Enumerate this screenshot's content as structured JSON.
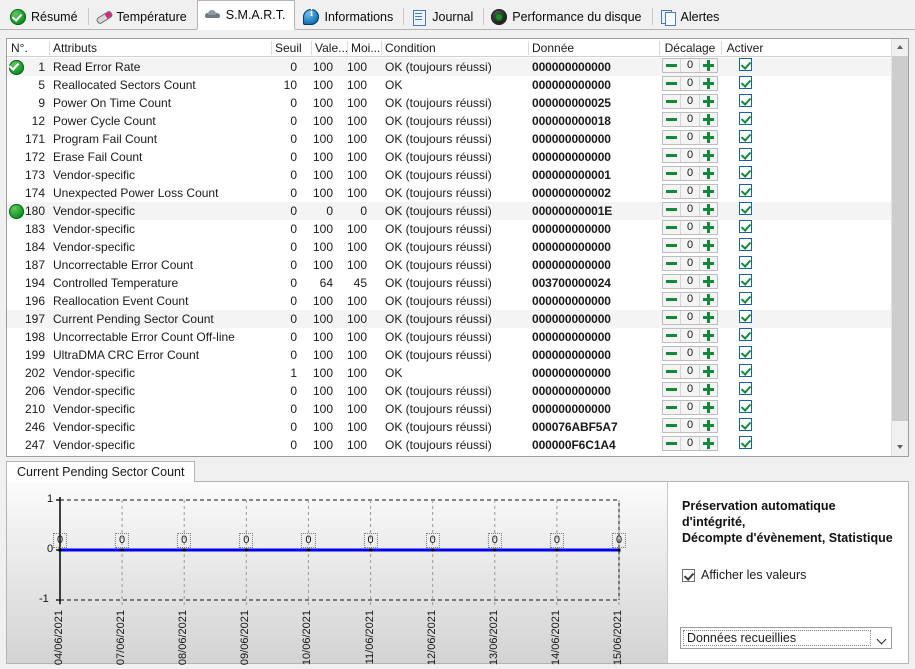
{
  "tabs": [
    {
      "label": "Résumé",
      "icon": "green-check-icon",
      "active": false
    },
    {
      "label": "Température",
      "icon": "thermometer-icon",
      "active": false
    },
    {
      "label": "S.M.A.R.T.",
      "icon": "smart-disk-icon",
      "active": true
    },
    {
      "label": "Informations",
      "icon": "info-icon",
      "active": false
    },
    {
      "label": "Journal",
      "icon": "document-icon",
      "active": false
    },
    {
      "label": "Performance du disque",
      "icon": "gauge-icon",
      "active": false
    },
    {
      "label": "Alertes",
      "icon": "copy-pages-icon",
      "active": false
    }
  ],
  "grid": {
    "columns": [
      "N°.",
      "Attributs",
      "Seuil",
      "Vale...",
      "Moi...",
      "Condition",
      "Donnée",
      "Décalage",
      "Activer"
    ],
    "rows": [
      {
        "status": "ok",
        "no": "1",
        "attr": "Read Error Rate",
        "seuil": "0",
        "valeur": "100",
        "moindre": "100",
        "condition": "OK (toujours réussi)",
        "donnee": "000000000000",
        "decalage": "0",
        "activer": true,
        "highlight": true
      },
      {
        "status": "",
        "no": "5",
        "attr": "Reallocated Sectors Count",
        "seuil": "10",
        "valeur": "100",
        "moindre": "100",
        "condition": "OK",
        "donnee": "000000000000",
        "decalage": "0",
        "activer": true,
        "highlight": false
      },
      {
        "status": "",
        "no": "9",
        "attr": "Power On Time Count",
        "seuil": "0",
        "valeur": "100",
        "moindre": "100",
        "condition": "OK (toujours réussi)",
        "donnee": "000000000025",
        "decalage": "0",
        "activer": true,
        "highlight": false
      },
      {
        "status": "",
        "no": "12",
        "attr": "Power Cycle Count",
        "seuil": "0",
        "valeur": "100",
        "moindre": "100",
        "condition": "OK (toujours réussi)",
        "donnee": "000000000018",
        "decalage": "0",
        "activer": true,
        "highlight": false
      },
      {
        "status": "",
        "no": "171",
        "attr": "Program Fail Count",
        "seuil": "0",
        "valeur": "100",
        "moindre": "100",
        "condition": "OK (toujours réussi)",
        "donnee": "000000000000",
        "decalage": "0",
        "activer": true,
        "highlight": false
      },
      {
        "status": "",
        "no": "172",
        "attr": "Erase Fail Count",
        "seuil": "0",
        "valeur": "100",
        "moindre": "100",
        "condition": "OK (toujours réussi)",
        "donnee": "000000000000",
        "decalage": "0",
        "activer": true,
        "highlight": false
      },
      {
        "status": "",
        "no": "173",
        "attr": "Vendor-specific",
        "seuil": "0",
        "valeur": "100",
        "moindre": "100",
        "condition": "OK (toujours réussi)",
        "donnee": "000000000001",
        "decalage": "0",
        "activer": true,
        "highlight": false
      },
      {
        "status": "",
        "no": "174",
        "attr": "Unexpected Power Loss Count",
        "seuil": "0",
        "valeur": "100",
        "moindre": "100",
        "condition": "OK (toujours réussi)",
        "donnee": "000000000002",
        "decalage": "0",
        "activer": true,
        "highlight": false
      },
      {
        "status": "ok",
        "no": "180",
        "attr": "Vendor-specific",
        "seuil": "0",
        "valeur": "0",
        "moindre": "0",
        "condition": "OK (toujours réussi)",
        "donnee": "00000000001E",
        "decalage": "0",
        "activer": true,
        "highlight": true
      },
      {
        "status": "",
        "no": "183",
        "attr": "Vendor-specific",
        "seuil": "0",
        "valeur": "100",
        "moindre": "100",
        "condition": "OK (toujours réussi)",
        "donnee": "000000000000",
        "decalage": "0",
        "activer": true,
        "highlight": false
      },
      {
        "status": "",
        "no": "184",
        "attr": "Vendor-specific",
        "seuil": "0",
        "valeur": "100",
        "moindre": "100",
        "condition": "OK (toujours réussi)",
        "donnee": "000000000000",
        "decalage": "0",
        "activer": true,
        "highlight": false
      },
      {
        "status": "",
        "no": "187",
        "attr": "Uncorrectable Error Count",
        "seuil": "0",
        "valeur": "100",
        "moindre": "100",
        "condition": "OK (toujours réussi)",
        "donnee": "000000000000",
        "decalage": "0",
        "activer": true,
        "highlight": false
      },
      {
        "status": "",
        "no": "194",
        "attr": "Controlled Temperature",
        "seuil": "0",
        "valeur": "64",
        "moindre": "45",
        "condition": "OK (toujours réussi)",
        "donnee": "003700000024",
        "decalage": "0",
        "activer": true,
        "highlight": false
      },
      {
        "status": "",
        "no": "196",
        "attr": "Reallocation Event Count",
        "seuil": "0",
        "valeur": "100",
        "moindre": "100",
        "condition": "OK (toujours réussi)",
        "donnee": "000000000000",
        "decalage": "0",
        "activer": true,
        "highlight": false
      },
      {
        "status": "",
        "no": "197",
        "attr": "Current Pending Sector Count",
        "seuil": "0",
        "valeur": "100",
        "moindre": "100",
        "condition": "OK (toujours réussi)",
        "donnee": "000000000000",
        "decalage": "0",
        "activer": true,
        "highlight": true
      },
      {
        "status": "",
        "no": "198",
        "attr": "Uncorrectable Error Count Off-line",
        "seuil": "0",
        "valeur": "100",
        "moindre": "100",
        "condition": "OK (toujours réussi)",
        "donnee": "000000000000",
        "decalage": "0",
        "activer": true,
        "highlight": false
      },
      {
        "status": "",
        "no": "199",
        "attr": "UltraDMA CRC Error Count",
        "seuil": "0",
        "valeur": "100",
        "moindre": "100",
        "condition": "OK (toujours réussi)",
        "donnee": "000000000000",
        "decalage": "0",
        "activer": true,
        "highlight": false
      },
      {
        "status": "",
        "no": "202",
        "attr": "Vendor-specific",
        "seuil": "1",
        "valeur": "100",
        "moindre": "100",
        "condition": "OK",
        "donnee": "000000000000",
        "decalage": "0",
        "activer": true,
        "highlight": false
      },
      {
        "status": "",
        "no": "206",
        "attr": "Vendor-specific",
        "seuil": "0",
        "valeur": "100",
        "moindre": "100",
        "condition": "OK (toujours réussi)",
        "donnee": "000000000000",
        "decalage": "0",
        "activer": true,
        "highlight": false
      },
      {
        "status": "",
        "no": "210",
        "attr": "Vendor-specific",
        "seuil": "0",
        "valeur": "100",
        "moindre": "100",
        "condition": "OK (toujours réussi)",
        "donnee": "000000000000",
        "decalage": "0",
        "activer": true,
        "highlight": false
      },
      {
        "status": "",
        "no": "246",
        "attr": "Vendor-specific",
        "seuil": "0",
        "valeur": "100",
        "moindre": "100",
        "condition": "OK (toujours réussi)",
        "donnee": "000076ABF5A7",
        "decalage": "0",
        "activer": true,
        "highlight": false
      },
      {
        "status": "",
        "no": "247",
        "attr": "Vendor-specific",
        "seuil": "0",
        "valeur": "100",
        "moindre": "100",
        "condition": "OK (toujours réussi)",
        "donnee": "000000F6C1A4",
        "decalage": "0",
        "activer": true,
        "highlight": false
      }
    ]
  },
  "bottom": {
    "tab_label": "Current Pending Sector Count",
    "side_title_line1": "Préservation automatique d'intégrité,",
    "side_title_line2": "Décompte d'évènement, Statistique",
    "show_values_label": "Afficher les valeurs",
    "show_values_checked": true,
    "combo_value": "Données recueillies"
  },
  "chart_data": {
    "type": "line",
    "title": "Current Pending Sector Count",
    "xlabel": "",
    "ylabel": "",
    "ylim": [
      -1,
      1
    ],
    "yticks": [
      1,
      0,
      -1
    ],
    "grid": true,
    "legend": false,
    "line_color": "#0000ee",
    "show_point_labels": true,
    "categories": [
      "04/06/2021",
      "07/06/2021",
      "08/06/2021",
      "09/06/2021",
      "10/06/2021",
      "11/06/2021",
      "12/06/2021",
      "13/06/2021",
      "14/06/2021",
      "15/06/2021"
    ],
    "series": [
      {
        "name": "Current Pending Sector Count",
        "values": [
          0,
          0,
          0,
          0,
          0,
          0,
          0,
          0,
          0,
          0
        ]
      }
    ]
  },
  "colors": {
    "accent_green": "#13883a",
    "line_blue": "#0000ee",
    "checkbox_border": "#1b5fa8"
  }
}
